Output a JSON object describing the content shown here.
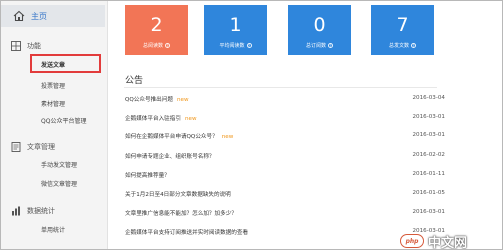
{
  "sidebar": {
    "home_label": "主页",
    "sections": [
      {
        "label": "功能",
        "icon": "grid-icon",
        "items": [
          "发送文章",
          "投票管理",
          "素材管理",
          "QQ公众平台管理"
        ]
      },
      {
        "label": "文章管理",
        "icon": "document-icon",
        "items": [
          "手动发文管理",
          "微信文章管理"
        ]
      },
      {
        "label": "数据统计",
        "icon": "bar-chart-icon",
        "items": [
          "单用统计"
        ]
      }
    ],
    "highlighted_item": "发送文章"
  },
  "stats": [
    {
      "value": "2",
      "caption": "总阅读数",
      "color": "#f27556"
    },
    {
      "value": "1",
      "caption": "平均阅读数",
      "color": "#2f86dc"
    },
    {
      "value": "0",
      "caption": "总订阅数",
      "color": "#2f86dc"
    },
    {
      "value": "7",
      "caption": "总发文数",
      "color": "#2f86dc"
    }
  ],
  "notices": {
    "title": "公告",
    "items": [
      {
        "text": "QQ公众号推出问题",
        "new": "new",
        "date": "2016-03-04"
      },
      {
        "text": "企鹅媒体平台入驻指引",
        "new": "new",
        "date": "2016-03-01"
      },
      {
        "text": "如何在企鹅媒体平台申请QQ公众号？",
        "new": "new",
        "date": "2016-03-01"
      },
      {
        "text": "如何申请专题企业、组织账号名称？",
        "new": "",
        "date": "2016-02-02"
      },
      {
        "text": "如何提高推荐量？",
        "new": "",
        "date": "2016-01-11"
      },
      {
        "text": "关于1月2日至4日部分文章数据缺失的说明",
        "new": "",
        "date": "2016-01-05"
      },
      {
        "text": "文章里推广信息能不能加？怎么加？加多少？",
        "new": "",
        "date": "2016-03-01"
      },
      {
        "text": "企鹅媒体平台支持订阅推送并实时阅读数据的查看",
        "new": "",
        "date": "2016-03-01"
      }
    ]
  },
  "watermark": {
    "logo_text": "php",
    "text": "中文网"
  }
}
